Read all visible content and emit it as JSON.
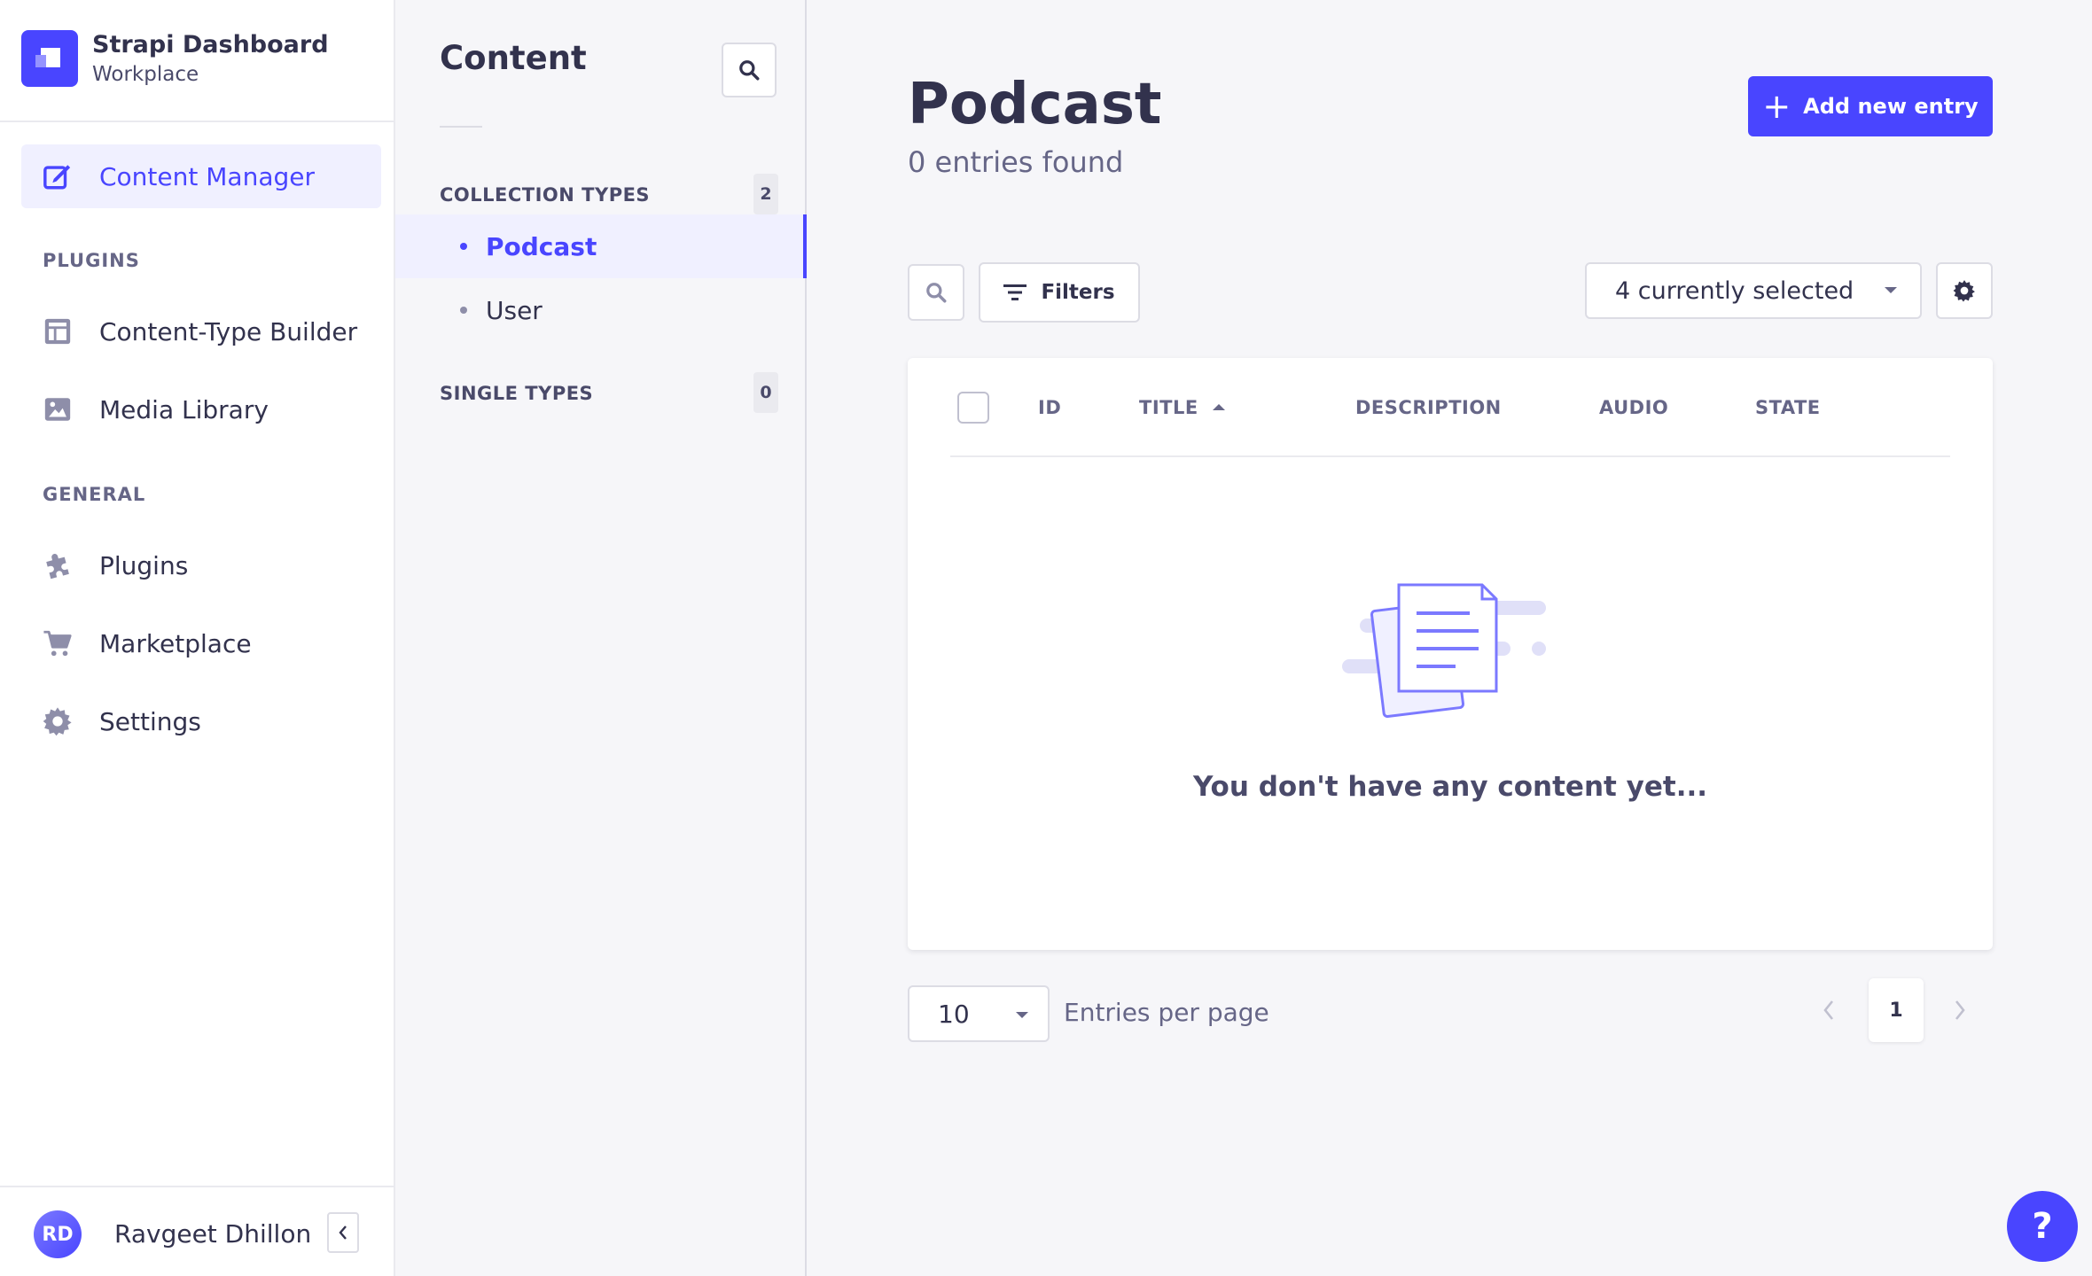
{
  "brand": {
    "title": "Strapi Dashboard",
    "subtitle": "Workplace"
  },
  "mainnav": {
    "active_item": "Content Manager",
    "sections": {
      "plugins": "PLUGINS",
      "general": "GENERAL"
    },
    "items": {
      "content_manager": "Content Manager",
      "content_type_builder": "Content-Type Builder",
      "media_library": "Media Library",
      "plugins": "Plugins",
      "marketplace": "Marketplace",
      "settings": "Settings"
    }
  },
  "user": {
    "initials": "RD",
    "name": "Ravgeet Dhillon"
  },
  "subnav": {
    "title": "Content",
    "collection_types": {
      "label": "COLLECTION TYPES",
      "count": "2",
      "items": [
        "Podcast",
        "User"
      ]
    },
    "single_types": {
      "label": "SINGLE TYPES",
      "count": "0"
    }
  },
  "main": {
    "title": "Podcast",
    "entries_found": "0 entries found",
    "add_button": "Add new entry",
    "filters_button": "Filters",
    "columns_select": "4 currently selected",
    "table": {
      "headers": [
        "ID",
        "TITLE",
        "DESCRIPTION",
        "AUDIO",
        "STATE"
      ],
      "sorted_column": "TITLE",
      "empty_message": "You don't have any content yet..."
    },
    "pagination": {
      "per_page_value": "10",
      "per_page_label": "Entries per page",
      "current_page": "1"
    },
    "help_button": "?"
  },
  "colors": {
    "primary": "#4945ff",
    "primary_light": "#f0f0ff",
    "text": "#32324d",
    "muted": "#666687"
  }
}
